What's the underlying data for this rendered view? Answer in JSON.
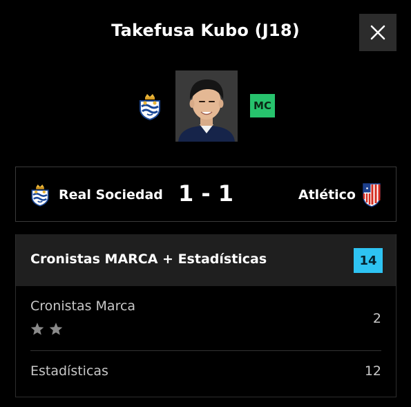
{
  "modal": {
    "title": "Takefusa Kubo (J18)",
    "close_icon": "close-icon"
  },
  "player": {
    "position": "MC",
    "position_color": "#27c36d",
    "club_crest_icon": "real-sociedad-crest-icon"
  },
  "match": {
    "home_team": "Real Sociedad",
    "score": "1 - 1",
    "away_team": "Atlético",
    "home_crest_icon": "real-sociedad-crest-icon",
    "away_crest_icon": "atletico-madrid-crest-icon"
  },
  "rating": {
    "title": "Cronistas MARCA + Estadísticas",
    "total": "14",
    "total_color": "#2ec3f2",
    "rows": [
      {
        "label": "Cronistas Marca",
        "value": "2",
        "stars": 2,
        "star_icon": "star-icon"
      },
      {
        "label": "Estadísticas",
        "value": "12"
      }
    ]
  }
}
